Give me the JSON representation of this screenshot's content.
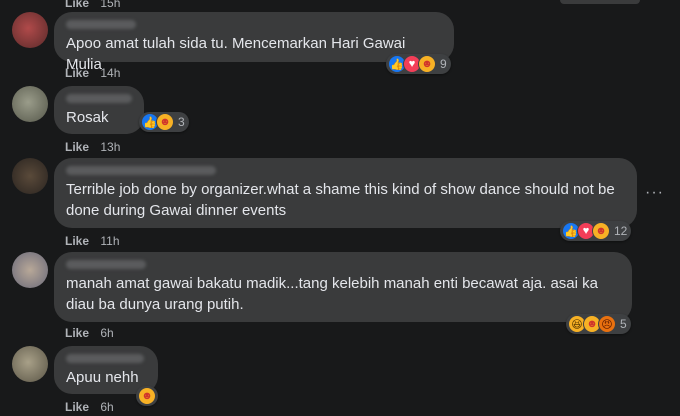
{
  "top_meta": {
    "like": "Like",
    "time": "15h"
  },
  "comments": [
    {
      "text": "Apoo amat tulah sida tu. Mencemarkan Hari Gawai Mulia",
      "like": "Like",
      "time": "14h",
      "count": "9"
    },
    {
      "text": "Rosak",
      "like": "Like",
      "time": "13h",
      "count": "3"
    },
    {
      "text": "Terrible job done by organizer.what a shame this kind of show dance should not be done during Gawai dinner events",
      "like": "Like",
      "time": "11h",
      "count": "12"
    },
    {
      "text": "manah amat gawai bakatu madik...tang kelebih manah enti becawat aja. asai ka diau ba dunya urang putih.",
      "like": "Like",
      "time": "6h",
      "count": "5"
    },
    {
      "text": "Apuu nehh",
      "like": "Like",
      "time": "6h",
      "count": ""
    }
  ],
  "more_icon": "more-horizontal-icon",
  "colors": {
    "background": "#18191a",
    "bubble": "#3a3b3c",
    "text": "#e4e6eb",
    "meta": "#b0b3b8"
  }
}
